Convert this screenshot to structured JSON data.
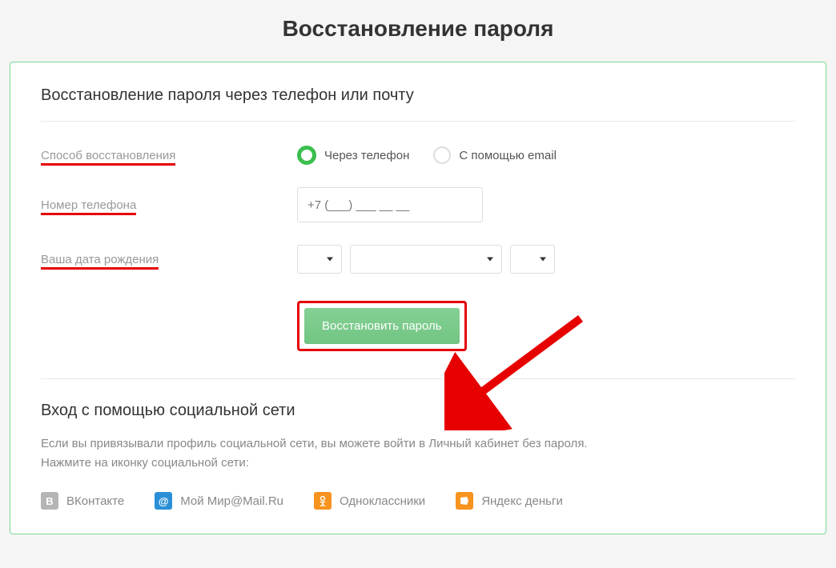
{
  "page_title": "Восстановление пароля",
  "form": {
    "title": "Восстановление пароля через телефон или почту",
    "method_label": "Способ восстановления",
    "radio_phone_label": "Через телефон",
    "radio_email_label": "С помощью email",
    "phone_label": "Номер телефона",
    "phone_placeholder": "+7 (___) ___ __ __",
    "dob_label": "Ваша дата рождения",
    "submit_label": "Восстановить пароль"
  },
  "social": {
    "title": "Вход с помощью социальной сети",
    "desc_line1": "Если вы привязывали профиль социальной сети, вы можете войти в Личный кабинет без пароля.",
    "desc_line2": "Нажмите на иконку социальной сети:",
    "links": {
      "vk": "ВКонтакте",
      "mailru": "Мой Мир@Mail.Ru",
      "ok": "Одноклассники",
      "yandex": "Яндекс деньги"
    }
  },
  "colors": {
    "accent_green": "#3abf4e",
    "highlight_red": "#e60000",
    "button_green": "#7acb8a"
  }
}
